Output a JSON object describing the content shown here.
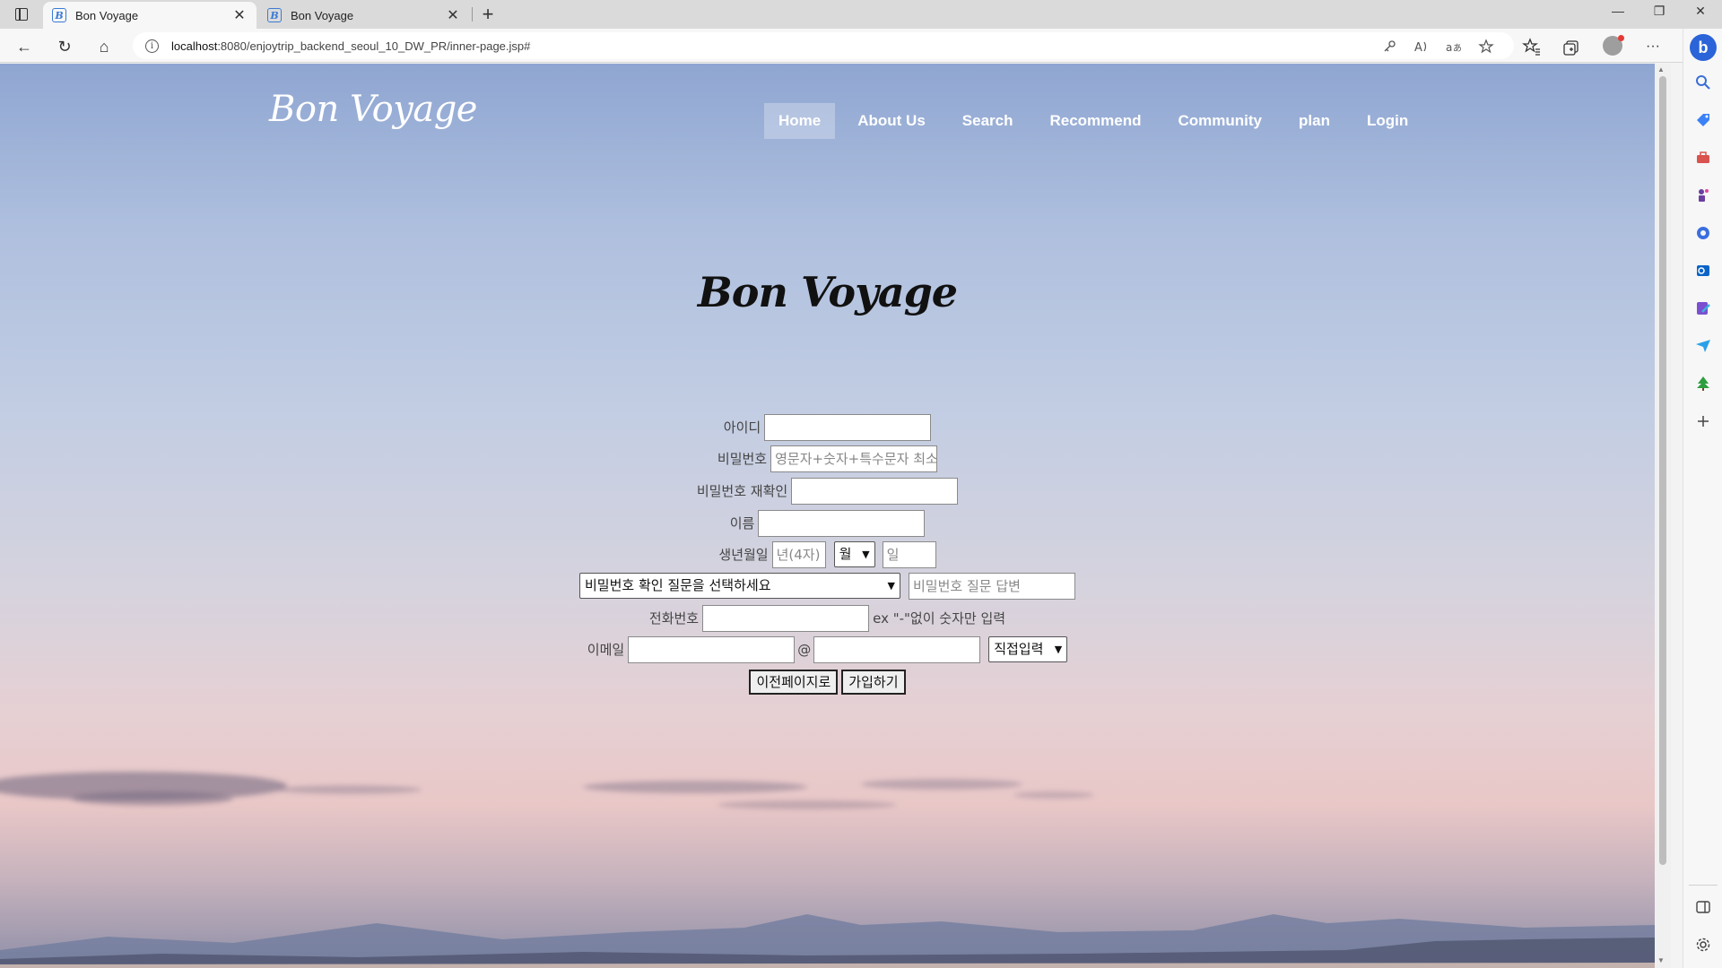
{
  "browser": {
    "tabs": [
      {
        "title": "Bon Voyage",
        "active": true
      },
      {
        "title": "Bon Voyage",
        "active": false
      }
    ],
    "favicon_letter": "B",
    "url_host": "localhost",
    "url_path": ":8080/enjoytrip_backend_seoul_10_DW_PR/inner-page.jsp#",
    "icons": {
      "back": "back-arrow-icon",
      "reload": "reload-icon",
      "home": "home-icon",
      "info": "info-icon",
      "more": "more-icon",
      "bing": "bing-icon"
    },
    "glyphs": {
      "close": "✕",
      "new_tab": "+",
      "minimize": "—",
      "restore": "❐",
      "win_close": "✕",
      "back": "←",
      "reload": "↻",
      "home": "⌂",
      "info": "i",
      "more": "···",
      "bing": "b"
    }
  },
  "site": {
    "logo": "Bon Voyage",
    "nav": [
      {
        "label": "Home",
        "active": true
      },
      {
        "label": "About Us",
        "active": false
      },
      {
        "label": "Search",
        "active": false
      },
      {
        "label": "Recommend",
        "active": false
      },
      {
        "label": "Community",
        "active": false
      },
      {
        "label": "plan",
        "active": false
      },
      {
        "label": "Login",
        "active": false
      }
    ],
    "form_title": "Bon Voyage"
  },
  "form": {
    "id_label": "아이디",
    "id_value": "",
    "pw_label": "비밀번호",
    "pw_placeholder": "영문자+숫자+특수문자 최소",
    "pw_confirm_label": "비밀번호 재확인",
    "pw_confirm_value": "",
    "name_label": "이름",
    "name_value": "",
    "birth_label": "생년월일",
    "birth_year_placeholder": "년(4자)",
    "birth_month_selected": "월",
    "birth_day_placeholder": "일",
    "question_selected": "비밀번호 확인 질문을 선택하세요",
    "answer_placeholder": "비밀번호  질문 답변",
    "phone_label": "전화번호",
    "phone_value": "",
    "phone_hint": "ex \"-\"없이 숫자만 입력",
    "email_label": "이메일",
    "email_at": "@",
    "email_domain_selected": "직접입력",
    "prev_button": "이전페이지로",
    "submit_button": "가입하기"
  },
  "colors": {
    "sky_top": "#8fa6d2",
    "sky_bottom": "#e9c7c7",
    "nav_active_bg": "rgba(255,255,255,0.28)"
  }
}
